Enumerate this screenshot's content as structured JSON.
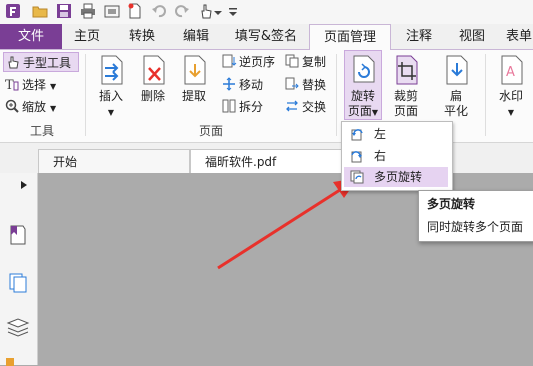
{
  "ribbon_tabs": {
    "file": "文件",
    "home": "主页",
    "convert": "转换",
    "edit": "编辑",
    "fill_sign": "填写&签名",
    "page_manage": "页面管理",
    "comment": "注释",
    "view": "视图",
    "form": "表单"
  },
  "tools_group": {
    "hand_tool": "手型工具",
    "select": "选择",
    "zoom": "缩放",
    "label": "工具"
  },
  "pages_group": {
    "insert": "插入",
    "delete": "删除",
    "extract": "提取",
    "reverse_order": "逆页序",
    "move": "移动",
    "split": "拆分",
    "copy": "复制",
    "replace": "替换",
    "swap": "交换",
    "label": "页面"
  },
  "page_tools": {
    "rotate_line1": "旋转",
    "rotate_line2": "页面",
    "crop_line1": "裁剪",
    "crop_line2": "页面",
    "flatten_line1": "扁",
    "flatten_line2": "平化",
    "watermark": "水印"
  },
  "rotate_menu": {
    "items": [
      "左",
      "右",
      "多页旋转"
    ],
    "selected": "多页旋转"
  },
  "tooltip": {
    "title": "多页旋转",
    "description": "同时旋转多个页面"
  },
  "doc_tabs": {
    "start": "开始",
    "file": "福昕软件.pdf"
  },
  "colors": {
    "accent": "#7a3e95",
    "highlight": "#e6d3f1",
    "arrow": "#e8312b",
    "canvas": "#ababab"
  }
}
